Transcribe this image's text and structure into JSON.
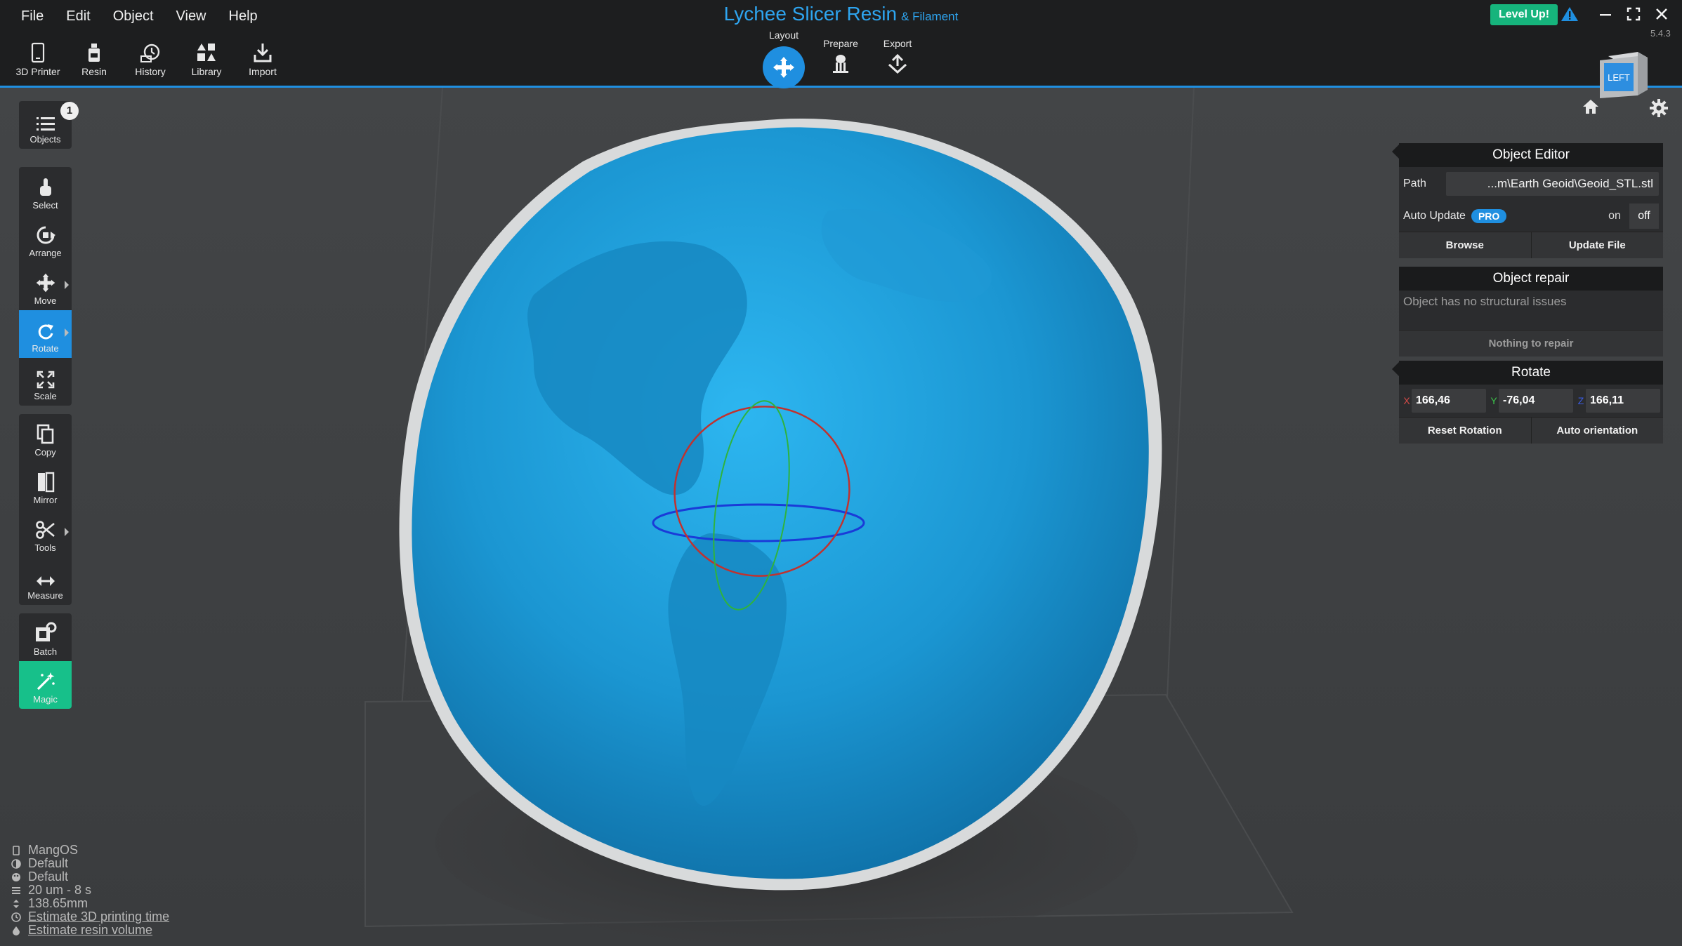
{
  "menu": {
    "items": [
      "File",
      "Edit",
      "Object",
      "View",
      "Help"
    ]
  },
  "title": {
    "main": "Lychee Slicer Resin",
    "sub": "& Filament"
  },
  "header": {
    "level_up": "Level Up!",
    "version": "5.4.3"
  },
  "toolbar": {
    "items": [
      "3D Printer",
      "Resin",
      "History",
      "Library",
      "Import"
    ]
  },
  "stages": {
    "layout": "Layout",
    "prepare": "Prepare",
    "export": "Export"
  },
  "view_cube": {
    "face": "LEFT"
  },
  "left_toolbar": {
    "objects": "Objects",
    "objects_count": "1",
    "select": "Select",
    "arrange": "Arrange",
    "move": "Move",
    "rotate": "Rotate",
    "scale": "Scale",
    "copy": "Copy",
    "mirror": "Mirror",
    "tools": "Tools",
    "measure": "Measure",
    "batch": "Batch",
    "magic": "Magic"
  },
  "object_editor": {
    "title": "Object Editor",
    "path_label": "Path",
    "path_value": "...m\\Earth Geoid\\Geoid_STL.stl",
    "auto_update_label": "Auto Update",
    "pro_badge": "PRO",
    "toggle_on": "on",
    "toggle_off": "off",
    "browse": "Browse",
    "update_file": "Update File"
  },
  "object_repair": {
    "title": "Object repair",
    "message": "Object has no structural issues",
    "action": "Nothing to repair"
  },
  "rotate_panel": {
    "title": "Rotate",
    "x_label": "X",
    "x_value": "166,46",
    "y_label": "Y",
    "y_value": "-76,04",
    "z_label": "Z",
    "z_value": "166,11",
    "reset": "Reset Rotation",
    "auto": "Auto orientation"
  },
  "info": {
    "printer": "MangOS",
    "resin": "Default",
    "settings": "Default",
    "layer": "20 um - 8 s",
    "height": "138.65mm",
    "estimate_time": "Estimate 3D printing time",
    "estimate_volume": "Estimate resin volume"
  },
  "colors": {
    "accent": "#1f8fe0",
    "magic": "#17c08a",
    "model": "#1aa0dc",
    "level_up": "#16b47c"
  }
}
